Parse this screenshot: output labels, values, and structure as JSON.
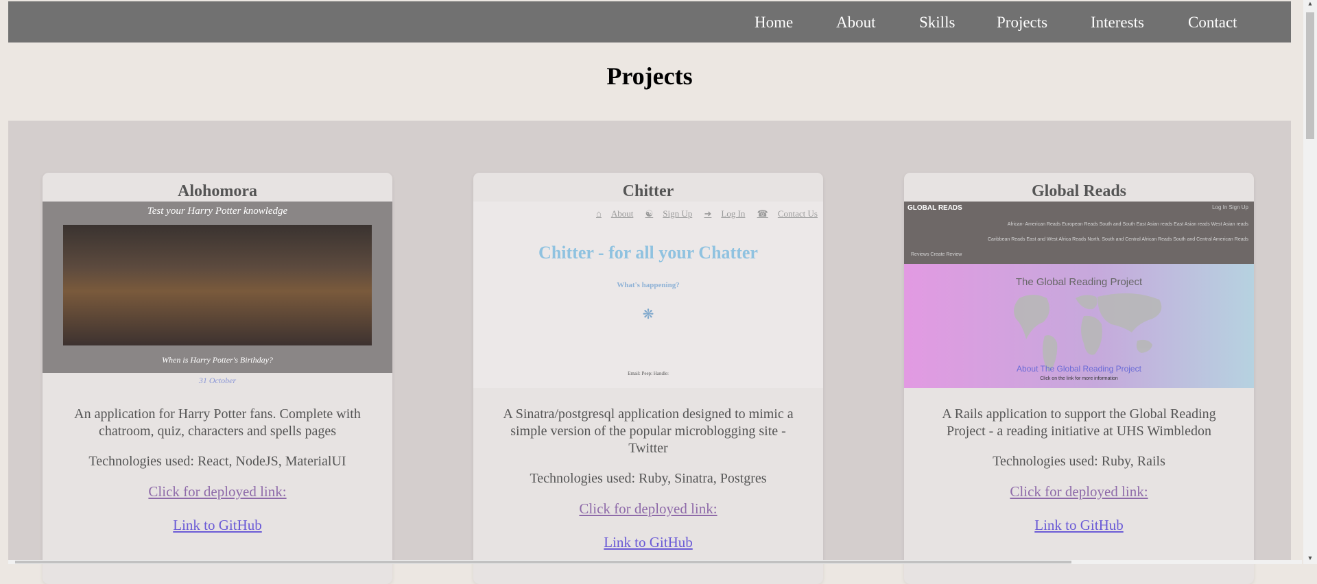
{
  "nav": {
    "items": [
      {
        "label": "Home"
      },
      {
        "label": "About"
      },
      {
        "label": "Skills"
      },
      {
        "label": "Projects"
      },
      {
        "label": "Interests"
      },
      {
        "label": "Contact"
      }
    ]
  },
  "section": {
    "title": "Projects"
  },
  "projects": [
    {
      "title": "Alohomora",
      "thumb": {
        "caption_top": "Test your Harry Potter knowledge",
        "caption_bottom": "When is Harry Potter's Birthday?",
        "answer": "31 October"
      },
      "description": "An application for Harry Potter fans. Complete with chatroom, quiz, characters and spells pages",
      "tech": "Technologies used: React, NodeJS, MaterialUI",
      "deployed_link": "Click for deployed link:",
      "github_link": "Link to GitHub"
    },
    {
      "title": "Chitter",
      "thumb": {
        "nav": [
          "About",
          "Sign Up",
          "Log In",
          "Contact Us"
        ],
        "headline": "Chitter - for all your Chatter",
        "subhead": "What's happening?",
        "form": "Email:  Peep:  Handle:"
      },
      "description": "A Sinatra/postgresql application designed to mimic a simple version of the popular microblogging site - Twitter",
      "tech": "Technologies used: Ruby, Sinatra, Postgres",
      "deployed_link": "Click for deployed link:",
      "github_link": "Link to GitHub"
    },
    {
      "title": "Global Reads",
      "thumb": {
        "brand": "GLOBAL READS",
        "auth": "Log In   Sign Up",
        "row1": "African- American Reads    European Reads    South and South East Asian reads    East Asian reads    West Asian reads",
        "row2": "Caribbean Reads    East and West Africa Reads    North, South and Central African Reads    South and Central American Reads",
        "row3": "Reviews    Create Review",
        "hero_title": "The Global Reading Project",
        "hero_about": "About The Global Reading Project",
        "hero_click": "Click on the link for more information"
      },
      "description": "A Rails application to support the Global Reading Project - a reading initiative at UHS Wimbledon",
      "tech": "Technologies used: Ruby, Rails",
      "deployed_link": "Click for deployed link:",
      "github_link": "Link to GitHub"
    }
  ],
  "colors": {
    "nav_bg": "#717171",
    "page_bg": "#ece7e2",
    "grid_bg": "#d4cecd",
    "card_bg": "#e7e3e2",
    "visited_link": "#8e6aa9",
    "link": "#6a5ad6"
  },
  "icons": [
    "home-icon",
    "user-plus-icon",
    "sign-in-icon",
    "phone-icon",
    "twitter-bird-icon"
  ]
}
